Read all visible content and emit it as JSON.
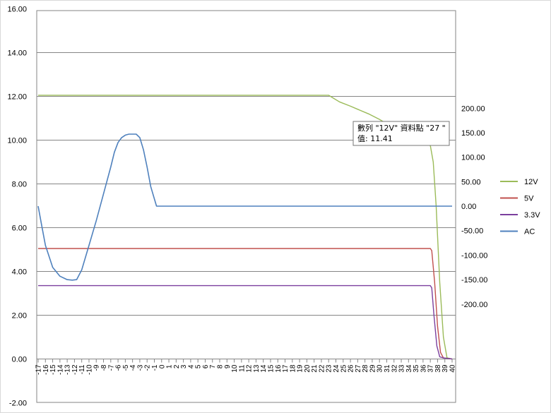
{
  "chart_data": {
    "type": "line",
    "title": "",
    "xlabel": "",
    "ylabel": "",
    "x_categories": [
      "-17",
      "-16",
      "-15",
      "-14",
      "-13",
      "-12",
      "-11",
      "-10",
      "-9",
      "-8",
      "-7",
      "-6",
      "-5",
      "-4",
      "-3",
      "-2",
      "-1",
      "0",
      "1",
      "2",
      "3",
      "4",
      "5",
      "6",
      "7",
      "8",
      "9",
      "10",
      "11",
      "12",
      "13",
      "14",
      "15",
      "16",
      "17",
      "18",
      "19",
      "20",
      "21",
      "22",
      "23",
      "24",
      "25",
      "26",
      "27",
      "28",
      "29",
      "30",
      "31",
      "32",
      "33",
      "34",
      "35",
      "36",
      "37",
      "38",
      "39",
      "40"
    ],
    "ylim_left": [
      -2,
      16
    ],
    "yticks_left": [
      "16.00",
      "14.00",
      "12.00",
      "10.00",
      "8.00",
      "6.00",
      "4.00",
      "2.00",
      "0.00",
      "-2.00"
    ],
    "ylim_right": [
      -200,
      200
    ],
    "yticks_right": [
      "200.00",
      "150.00",
      "100.00",
      "50.00",
      "0.00",
      "-50.00",
      "-100.00",
      "-150.00",
      "-200.00"
    ],
    "grid": true,
    "legend_position": "right",
    "series": [
      {
        "name": "12V",
        "color": "#9bbb59",
        "axis": "left",
        "points": [
          [
            -17,
            12.05
          ],
          [
            23,
            12.05
          ],
          [
            23.5,
            11.95
          ],
          [
            24.5,
            11.75
          ],
          [
            26,
            11.55
          ],
          [
            27,
            11.41
          ],
          [
            28.5,
            11.2
          ],
          [
            30,
            10.95
          ],
          [
            31.5,
            10.65
          ],
          [
            33,
            10.35
          ],
          [
            34.5,
            10.1
          ],
          [
            36,
            9.9
          ],
          [
            37,
            9.75
          ],
          [
            37.4,
            9.0
          ],
          [
            37.8,
            7.0
          ],
          [
            38.3,
            3.5
          ],
          [
            38.8,
            1.0
          ],
          [
            39.3,
            0.05
          ],
          [
            40,
            0.0
          ]
        ]
      },
      {
        "name": "5V",
        "color": "#c0504d",
        "axis": "left",
        "points": [
          [
            -17,
            5.05
          ],
          [
            37,
            5.05
          ],
          [
            37.2,
            4.95
          ],
          [
            37.6,
            3.5
          ],
          [
            38,
            1.5
          ],
          [
            38.4,
            0.3
          ],
          [
            38.8,
            0.05
          ],
          [
            40,
            0.0
          ]
        ]
      },
      {
        "name": "3.3V",
        "color": "#7b3f9e",
        "axis": "left",
        "points": [
          [
            -17,
            3.35
          ],
          [
            37,
            3.35
          ],
          [
            37.2,
            3.25
          ],
          [
            37.5,
            2.0
          ],
          [
            37.9,
            0.6
          ],
          [
            38.3,
            0.1
          ],
          [
            38.8,
            0.05
          ],
          [
            40,
            0.0
          ]
        ]
      },
      {
        "name": "AC",
        "color": "#4f81bd",
        "axis": "right",
        "points": [
          [
            -17,
            0
          ],
          [
            -16.5,
            -40
          ],
          [
            -16,
            -80
          ],
          [
            -15,
            -125
          ],
          [
            -14,
            -143
          ],
          [
            -13,
            -150
          ],
          [
            -12.3,
            -151
          ],
          [
            -11.7,
            -150
          ],
          [
            -11,
            -130
          ],
          [
            -10,
            -80
          ],
          [
            -9,
            -30
          ],
          [
            -8,
            25
          ],
          [
            -7,
            80
          ],
          [
            -6.5,
            110
          ],
          [
            -6,
            130
          ],
          [
            -5.5,
            140
          ],
          [
            -5,
            145
          ],
          [
            -4.5,
            147
          ],
          [
            -3.5,
            147
          ],
          [
            -3,
            140
          ],
          [
            -2.5,
            115
          ],
          [
            -2,
            80
          ],
          [
            -1.5,
            40
          ],
          [
            -1,
            15
          ],
          [
            -0.7,
            0
          ],
          [
            40,
            0
          ]
        ]
      }
    ],
    "tooltip": {
      "line1": "數列 \"12V\" 資料點 \"27 \"",
      "line2": "值: 11.41",
      "x": 27,
      "y": 11.41
    }
  }
}
